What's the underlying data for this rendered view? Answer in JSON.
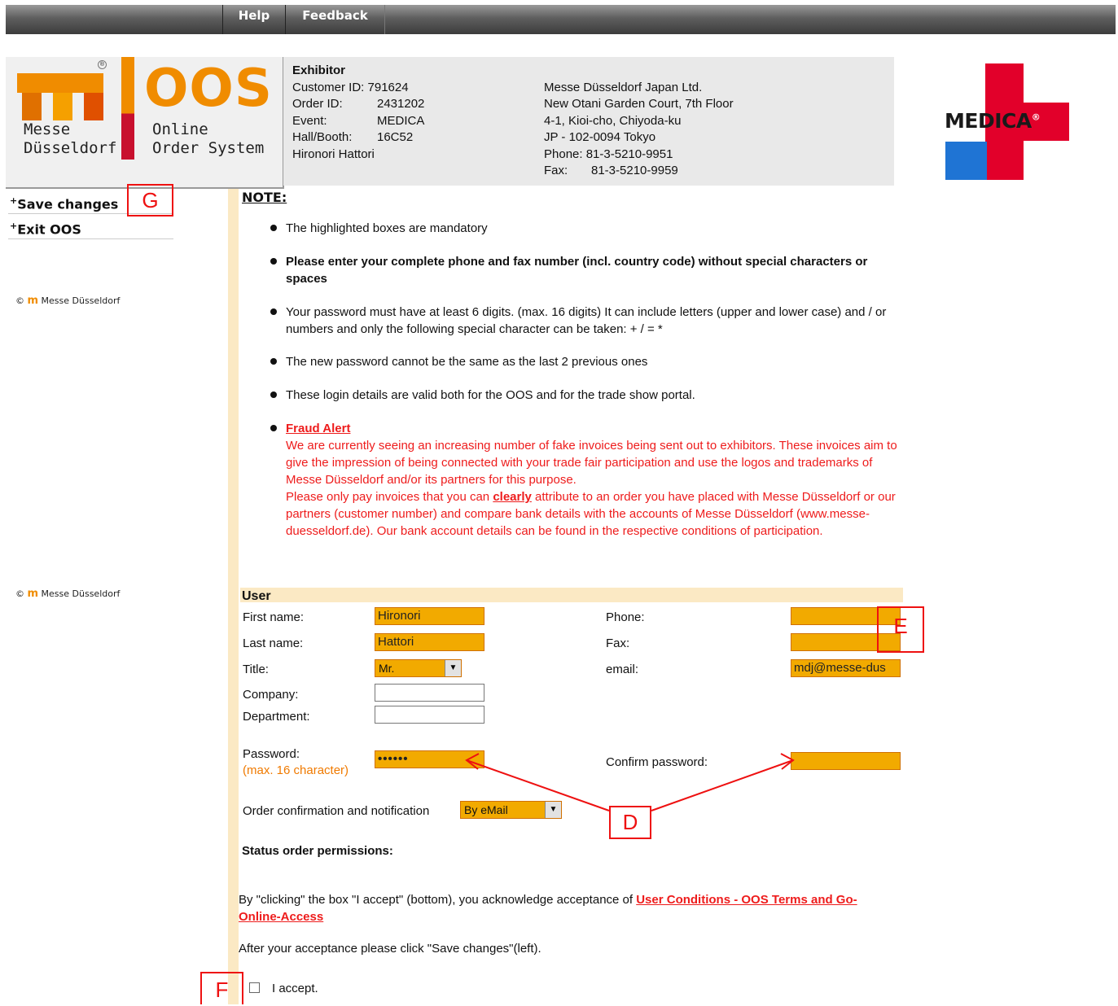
{
  "topbar": {
    "help": "Help",
    "feedback": "Feedback"
  },
  "logo": {
    "brand": "OOS",
    "line1_left": "Messe",
    "line2_left": "Düsseldorf",
    "line1_right": "Online",
    "line2_right": "Order System",
    "mark": "m"
  },
  "exhibitor": {
    "title": "Exhibitor",
    "customer_id_label": "Customer ID:",
    "customer_id": "791624",
    "order_id_label": "Order ID:",
    "order_id": "2431202",
    "event_label": "Event:",
    "event": "MEDICA",
    "booth_label": "Hall/Booth:",
    "booth": "16C52",
    "contact": "Hironori Hattori",
    "address": {
      "company": "Messe Düsseldorf Japan Ltd.",
      "line1": "New Otani Garden Court, 7th Floor",
      "line2": "4-1, Kioi-cho, Chiyoda-ku",
      "line3": "JP - 102-0094 Tokyo",
      "phone": "Phone: 81-3-5210-9951",
      "fax_label": "Fax:",
      "fax": "81-3-5210-9959"
    }
  },
  "medica_logo": {
    "text": "MEDICA",
    "reg": "®"
  },
  "nav": {
    "save": "Save changes",
    "exit": "Exit OOS",
    "plus": "+"
  },
  "copyright": {
    "symbol": "©",
    "text": "Messe Düsseldorf"
  },
  "note": {
    "title": "NOTE:",
    "b1": "The highlighted boxes are mandatory",
    "b2": "Please enter your complete phone and fax number (incl. country code) without special characters or spaces",
    "b3": "Your password must have at least 6 digits. (max. 16 digits) It can include letters (upper and lower case) and / or numbers and only the following special character can be taken: + / = *",
    "b4": "The new password cannot be the same as the last 2 previous ones",
    "b5": "These login details are valid both for the OOS and for the trade show portal.",
    "fraud_title": "Fraud Alert",
    "fraud_p1": "We are currently seeing an increasing number of fake invoices being sent out to exhibitors. These invoices aim to give the impression of being connected with your trade fair participation and use the logos and trademarks of Messe Düsseldorf and/or its partners for this purpose.",
    "fraud_p2a": "Please only pay invoices that you can ",
    "fraud_p2b": "clearly",
    "fraud_p2c": " attribute to an order you have placed with Messe Düsseldorf or our partners (customer number) and compare bank details with the accounts of Messe Düsseldorf (www.messe-duesseldorf.de). Our bank account details can be found in the respective conditions of participation."
  },
  "user": {
    "header": "User",
    "first_name_label": "First name:",
    "first_name": "Hironori",
    "last_name_label": "Last name:",
    "last_name": "Hattori",
    "title_label": "Title:",
    "title": "Mr.",
    "company_label": "Company:",
    "company": "",
    "department_label": "Department:",
    "department": "",
    "phone_label": "Phone:",
    "phone": "",
    "fax_label": "Fax:",
    "fax": "",
    "email_label": "email:",
    "email": "mdj@messe-dus",
    "password_label": "Password:",
    "password_hint": "(max. 16 character)",
    "password_mask": "••••••",
    "confirm_label": "Confirm password:",
    "confirm": "",
    "order_conf_label": "Order confirmation and notification",
    "order_conf": "By eMail",
    "status_label": "Status order permissions:"
  },
  "terms": {
    "text": "By \"clicking\" the box \"I accept\" (bottom), you acknowledge acceptance of ",
    "link": "User Conditions - OOS Terms and Go-Online-Access",
    "after": "After your acceptance please click \"Save changes\"(left).",
    "accept": "I accept."
  },
  "annotations": {
    "g": "G",
    "e": "E",
    "d": "D",
    "f": "F"
  },
  "colors": {
    "mandatory": "#f2aa00",
    "accent_red": "#ee1c1c",
    "note_stripe": "#fbe9c4"
  }
}
